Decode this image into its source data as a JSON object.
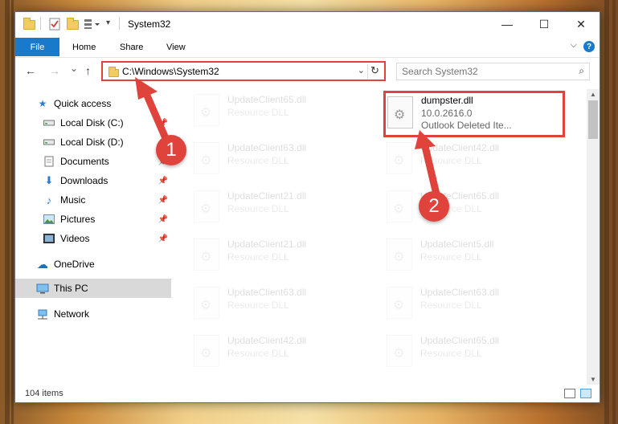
{
  "window": {
    "title": "System32",
    "minimize": "—",
    "maximize": "☐",
    "close": "✕"
  },
  "ribbon": {
    "file": "File",
    "tabs": [
      "Home",
      "Share",
      "View"
    ],
    "help": "?",
    "expand": "⌵"
  },
  "nav": {
    "back": "←",
    "forward": "→",
    "recent": "⌄",
    "up": "↑",
    "address": "C:\\Windows\\System32",
    "address_chevron": "⌄",
    "refresh": "↻",
    "search_placeholder": "Search System32",
    "search_icon": "search-icon"
  },
  "sidebar": {
    "items": [
      {
        "label": "Quick access",
        "icon": "star-icon",
        "pinned": false
      },
      {
        "label": "Local Disk (C:)",
        "icon": "drive-icon",
        "pinned": true
      },
      {
        "label": "Local Disk (D:)",
        "icon": "drive-icon",
        "pinned": false
      },
      {
        "label": "Documents",
        "icon": "documents-icon",
        "pinned": true
      },
      {
        "label": "Downloads",
        "icon": "download-icon",
        "pinned": true
      },
      {
        "label": "Music",
        "icon": "music-icon",
        "pinned": true
      },
      {
        "label": "Pictures",
        "icon": "pictures-icon",
        "pinned": true
      },
      {
        "label": "Videos",
        "icon": "videos-icon",
        "pinned": true
      },
      {
        "label": "OneDrive",
        "icon": "cloud-icon",
        "pinned": false
      },
      {
        "label": "This PC",
        "icon": "computer-icon",
        "pinned": false,
        "selected": true
      },
      {
        "label": "Network",
        "icon": "network-icon",
        "pinned": false
      }
    ],
    "pin_glyph": "📌"
  },
  "files": {
    "highlighted": {
      "name": "dumpster.dll",
      "version": "10.0.2616.0",
      "description": "Outlook Deleted Ite..."
    },
    "left_column": [
      {
        "name": "UpdateClient65.dll",
        "type": "Resource DLL"
      },
      {
        "name": "UpdateClient63.dll",
        "type": "Resource DLL"
      },
      {
        "name": "UpdateClient21.dll",
        "type": "Resource DLL"
      },
      {
        "name": "UpdateClient21.dll",
        "type": "Resource DLL"
      },
      {
        "name": "UpdateClient63.dll",
        "type": "Resource DLL"
      },
      {
        "name": "UpdateClient42.dll",
        "type": "Resource DLL"
      }
    ],
    "right_column": [
      {
        "name": "UpdateClient42.dll",
        "type": "Resource DLL"
      },
      {
        "name": "UpdateClient65.dll",
        "type": "Resource DLL"
      },
      {
        "name": "UpdateClient5.dll",
        "type": "Resource DLL"
      },
      {
        "name": "UpdateClient63.dll",
        "type": "Resource DLL"
      },
      {
        "name": "UpdateClient65.dll",
        "type": "Resource DLL"
      }
    ]
  },
  "status": {
    "item_count": "104 items"
  },
  "callouts": [
    "1",
    "2"
  ],
  "colors": {
    "accent": "#1979ca",
    "highlight": "#e0423c"
  }
}
